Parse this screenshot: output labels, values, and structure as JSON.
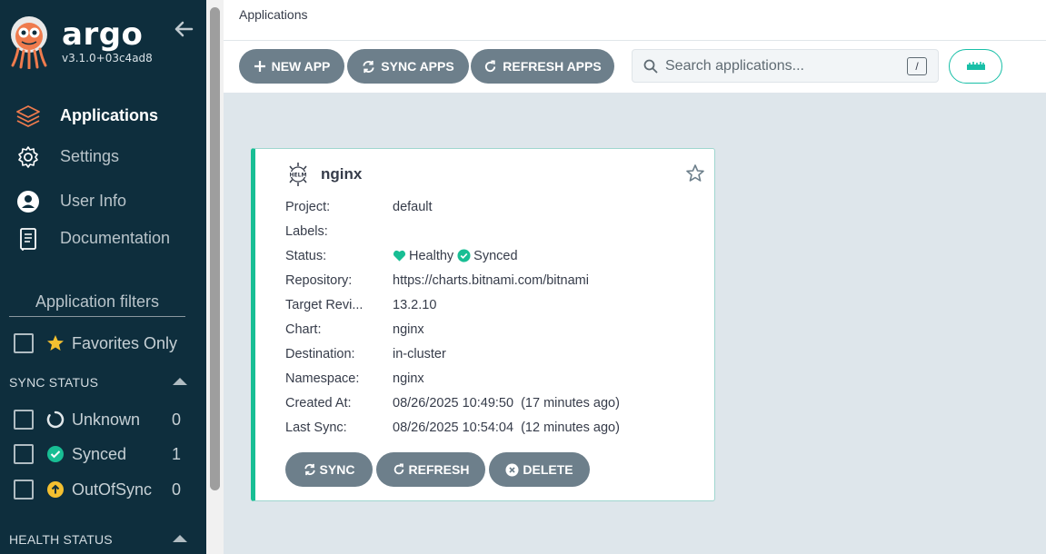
{
  "sidebar": {
    "brand_name": "argo",
    "version": "v3.1.0+03c4ad8",
    "nav": [
      {
        "label": "Applications",
        "icon": "layers-icon",
        "active": true
      },
      {
        "label": "Settings",
        "icon": "gear-icon",
        "active": false
      },
      {
        "label": "User Info",
        "icon": "user-icon",
        "active": false
      },
      {
        "label": "Documentation",
        "icon": "book-icon",
        "active": false
      }
    ],
    "filters_title": "Application filters",
    "favorites_label": "Favorites Only",
    "sync_status_title": "SYNC STATUS",
    "sync_filters": [
      {
        "label": "Unknown",
        "count": "0"
      },
      {
        "label": "Synced",
        "count": "1"
      },
      {
        "label": "OutOfSync",
        "count": "0"
      }
    ],
    "health_status_title": "HEALTH STATUS"
  },
  "header": {
    "breadcrumb": "Applications"
  },
  "toolbar": {
    "new_app": "NEW APP",
    "sync_apps": "SYNC APPS",
    "refresh_apps": "REFRESH APPS",
    "search_placeholder": "Search applications...",
    "search_shortcut": "/"
  },
  "app_card": {
    "name": "nginx",
    "icon": "helm-icon",
    "rows": [
      {
        "key": "Project:",
        "value": "default"
      },
      {
        "key": "Labels:",
        "value": ""
      },
      {
        "key": "Status:",
        "value": ""
      },
      {
        "key": "Repository:",
        "value": "https://charts.bitnami.com/bitnami"
      },
      {
        "key": "Target Revi...",
        "value": "13.2.10"
      },
      {
        "key": "Chart:",
        "value": "nginx"
      },
      {
        "key": "Destination:",
        "value": "in-cluster"
      },
      {
        "key": "Namespace:",
        "value": "nginx"
      },
      {
        "key": "Created At:",
        "value": "08/26/2025 10:49:50  (17 minutes ago)"
      },
      {
        "key": "Last Sync:",
        "value": "08/26/2025 10:54:04  (12 minutes ago)"
      }
    ],
    "health": "Healthy",
    "sync": "Synced",
    "actions": {
      "sync": "SYNC",
      "refresh": "REFRESH",
      "delete": "DELETE"
    }
  },
  "colors": {
    "sidebar_bg": "#0e2e3d",
    "button_bg": "#6d7f8b",
    "accent_teal": "#18be94",
    "warning_yellow": "#f4c030",
    "brand_orange": "#ef7b4d"
  }
}
